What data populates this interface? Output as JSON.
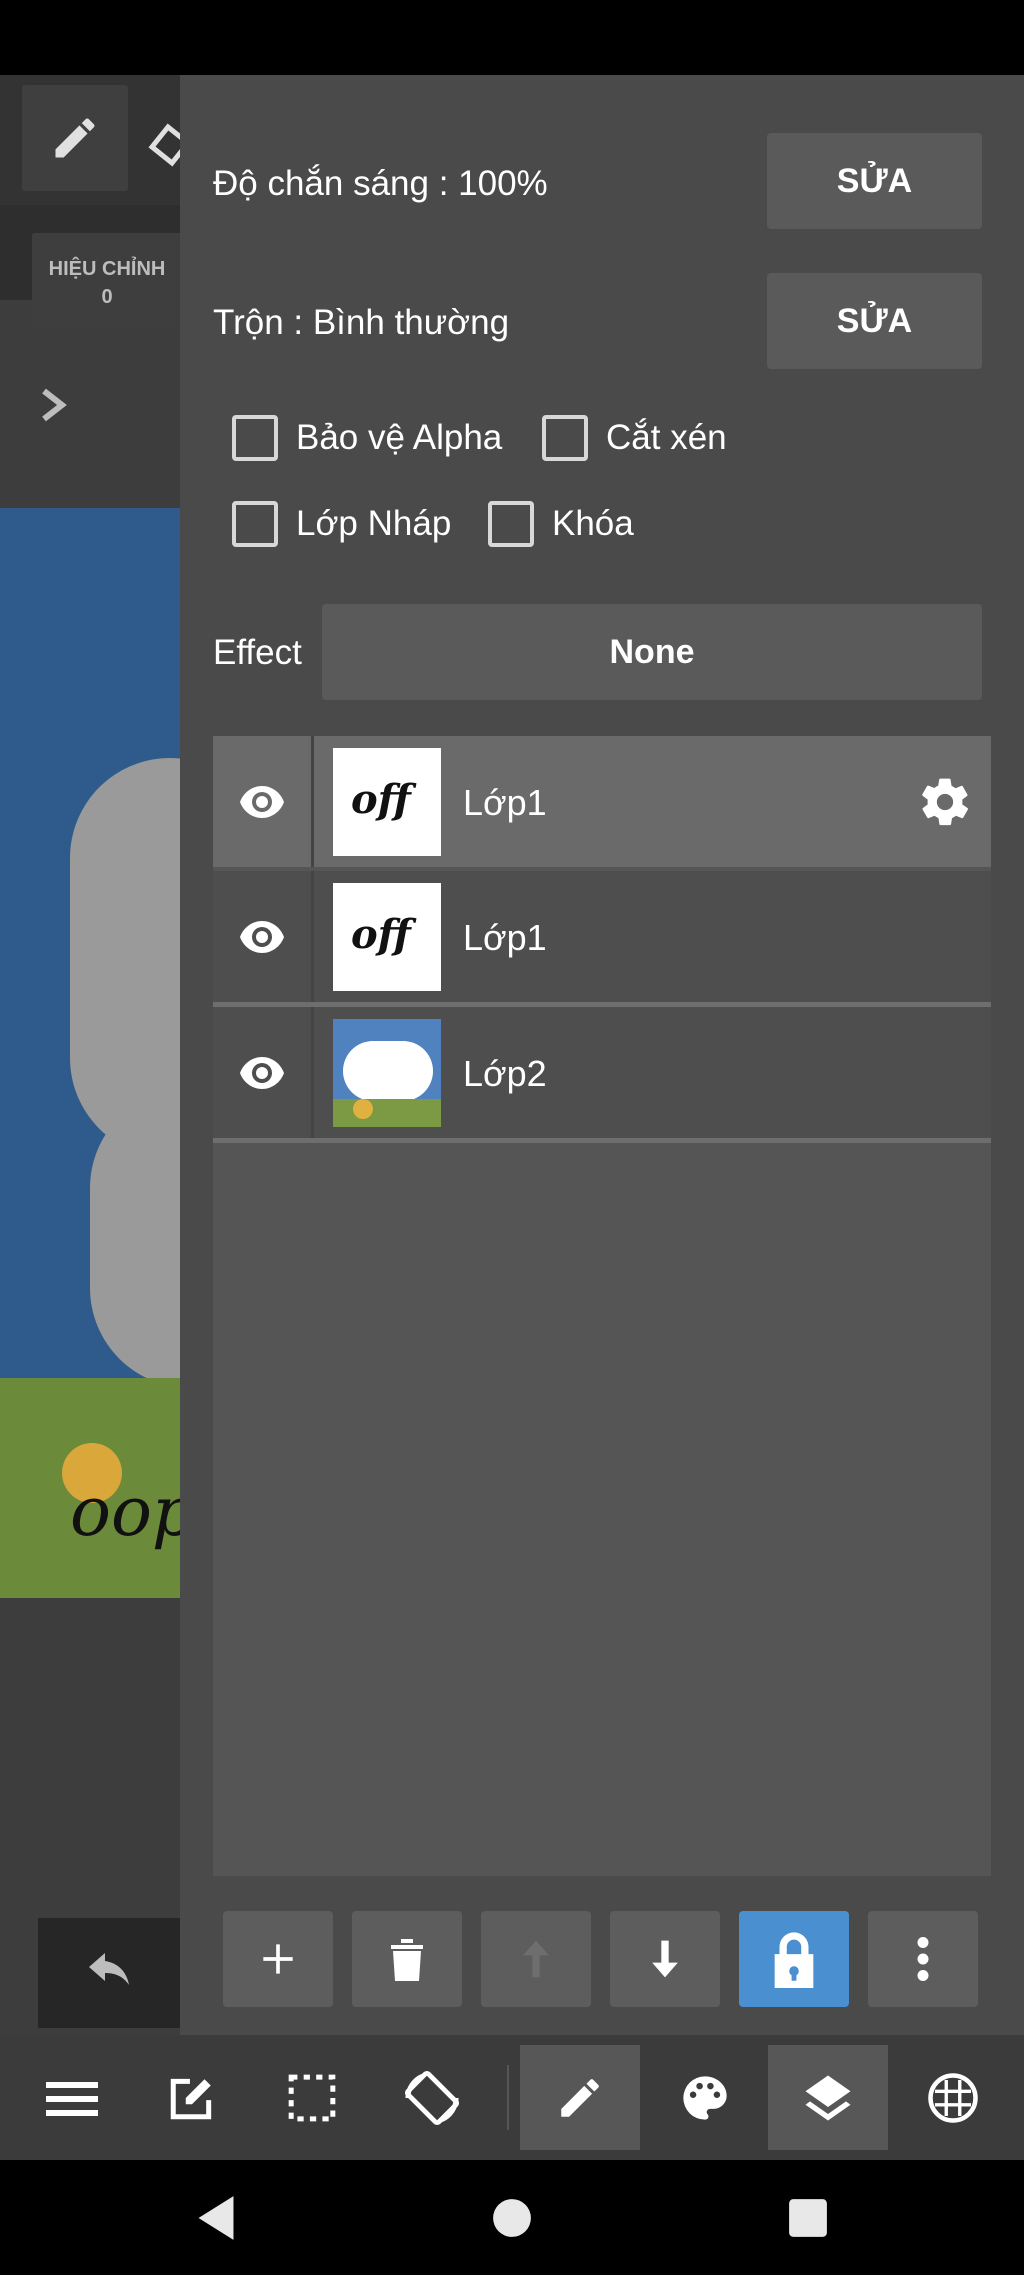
{
  "background_app": {
    "adjust_label": "HIỆU CHỈNH",
    "adjust_value": "0",
    "canvas_text": "oop"
  },
  "panel": {
    "opacity_label": "Độ chắn sáng : 100%",
    "opacity_button": "SỬA",
    "blend_label": "Trộn : Bình thường",
    "blend_button": "SỬA",
    "checkboxes": [
      {
        "label": "Bảo vệ Alpha",
        "checked": false
      },
      {
        "label": "Cắt xén",
        "checked": false
      },
      {
        "label": "Lớp Nháp",
        "checked": false
      },
      {
        "label": "Khóa",
        "checked": false
      }
    ],
    "effect_label": "Effect",
    "effect_value": "None"
  },
  "layers": [
    {
      "name": "Lớp1",
      "thumb_text": "off",
      "selected": true,
      "visible": true
    },
    {
      "name": "Lớp1",
      "thumb_text": "off",
      "selected": false,
      "visible": true
    },
    {
      "name": "Lớp2",
      "thumb_text": "",
      "selected": false,
      "visible": true
    }
  ],
  "layer_actions": [
    "add-layer",
    "delete-layer",
    "move-up",
    "move-down",
    "lock",
    "more"
  ],
  "bottom_toolbar": [
    "menu",
    "edit",
    "selection",
    "rotate",
    "brush",
    "palette",
    "layers",
    "settings"
  ],
  "colors": {
    "panel": "#4a4a4a",
    "button": "#5a5a5a",
    "accent_blue": "#4a8fcf",
    "selected_layer": "#6a6a6a"
  }
}
